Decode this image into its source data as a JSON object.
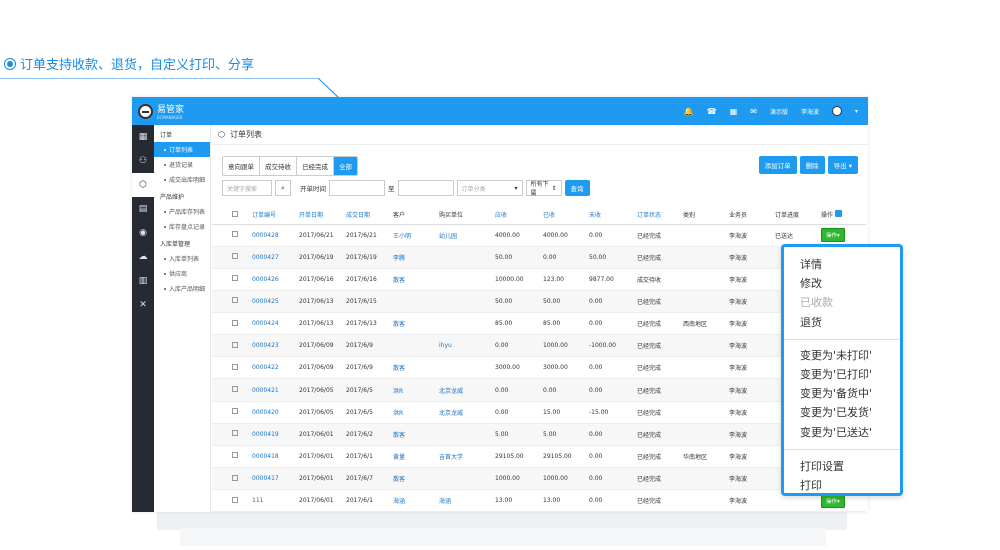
{
  "caption": "订单支持收款、退货，自定义打印、分享",
  "app": {
    "name": "易管家",
    "sub": "ECMANAGER",
    "top_links": [
      "演示版",
      "李海波"
    ]
  },
  "page_title": "订单列表",
  "sidebar": {
    "group1": "订单",
    "g1_items": [
      "订单列表",
      "退货记录",
      "成交出库明细"
    ],
    "group2": "产品维护",
    "g2_items": [
      "产品库存列表",
      "库存盘点记录"
    ],
    "group3": "入库单管理",
    "g3_items": [
      "入库单列表",
      "供应商",
      "入库产品明细"
    ]
  },
  "tabs": [
    "意向跟单",
    "成交待收",
    "已经完成",
    "全部"
  ],
  "actions": {
    "add": "添加订单",
    "delete": "删除",
    "export": "导出"
  },
  "filters": {
    "keyword_placeholder": "关键字搜索",
    "time_label": "开单时间",
    "to": "至",
    "category_placeholder": "订单分类",
    "select": "所有下属",
    "search": "查询"
  },
  "columns": [
    "订单编号",
    "开单日期",
    "成交日期",
    "客户",
    "购买单位",
    "应收",
    "已收",
    "未收",
    "订单状态",
    "类别",
    "业务员",
    "订单进度",
    "操作"
  ],
  "rows": [
    [
      "0000428",
      "2017/06/21",
      "2017/6/21",
      "王小明",
      "幼儿园",
      "4000.00",
      "4000.00",
      "0.00",
      "已经完成",
      "",
      "李海波",
      "已送达",
      "操作"
    ],
    [
      "0000427",
      "2017/06/19",
      "2017/6/19",
      "李腾",
      "",
      "50.00",
      "0.00",
      "50.00",
      "已经完成",
      "",
      "李海波",
      "",
      ""
    ],
    [
      "0000426",
      "2017/06/16",
      "2017/6/16",
      "散客",
      "",
      "10000.00",
      "123.00",
      "9877.00",
      "成交待收",
      "",
      "李海波",
      "",
      ""
    ],
    [
      "0000425",
      "2017/06/13",
      "2017/6/15",
      "",
      "",
      "50.00",
      "50.00",
      "0.00",
      "已经完成",
      "",
      "李海波",
      "",
      ""
    ],
    [
      "0000424",
      "2017/06/13",
      "2017/6/13",
      "散客",
      "",
      "85.00",
      "85.00",
      "0.00",
      "已经完成",
      "西南地区",
      "李海波",
      "",
      ""
    ],
    [
      "0000423",
      "2017/06/09",
      "2017/6/9",
      "",
      "ihyu",
      "0.00",
      "1000.00",
      "-1000.00",
      "已经完成",
      "",
      "李海波",
      "",
      ""
    ],
    [
      "0000422",
      "2017/06/09",
      "2017/6/9",
      "散客",
      "",
      "3000.00",
      "3000.00",
      "0.00",
      "已经完成",
      "",
      "李海波",
      "",
      ""
    ],
    [
      "0000421",
      "2017/06/05",
      "2017/6/5",
      "洪R",
      "北京龙威",
      "0.00",
      "0.00",
      "0.00",
      "已经完成",
      "",
      "李海波",
      "",
      ""
    ],
    [
      "0000420",
      "2017/06/05",
      "2017/6/5",
      "洪R",
      "北京龙威",
      "0.00",
      "15.00",
      "-15.00",
      "已经完成",
      "",
      "李海波",
      "",
      ""
    ],
    [
      "0000419",
      "2017/06/01",
      "2017/6/2",
      "散客",
      "",
      "5.00",
      "5.00",
      "0.00",
      "已经完成",
      "",
      "李海波",
      "",
      ""
    ],
    [
      "0000418",
      "2017/06/01",
      "2017/6/1",
      "黄量",
      "吉首大学",
      "29105.00",
      "29105.00",
      "0.00",
      "已经完成",
      "华南地区",
      "李海波",
      "",
      ""
    ],
    [
      "0000417",
      "2017/06/01",
      "2017/6/7",
      "散客",
      "",
      "1000.00",
      "1000.00",
      "0.00",
      "已经完成",
      "",
      "李海波",
      "",
      ""
    ],
    [
      "111",
      "2017/06/01",
      "2017/6/1",
      "海涵",
      "海涵",
      "13.00",
      "13.00",
      "0.00",
      "已经完成",
      "",
      "李海波",
      "",
      "操作"
    ]
  ],
  "menu": {
    "items": [
      "详情",
      "修改",
      "已收款",
      "退货",
      "变更为'未打印'",
      "变更为'已打印'",
      "变更为'备货中'",
      "变更为'已发货'",
      "变更为'已送达'",
      "打印设置",
      "打印"
    ]
  }
}
